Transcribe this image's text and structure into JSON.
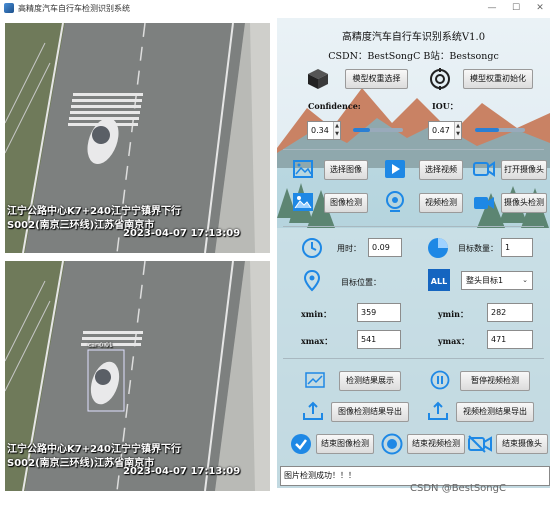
{
  "window": {
    "title": "高精度汽车自行车检测识别系统",
    "controls": [
      "—",
      "☐",
      "✕"
    ]
  },
  "top_image": {
    "overlay_line1": "江宁公路中心K7+240江宁宁镇界下行",
    "overlay_line2": "S002(南京三环线)江苏省南京市",
    "timestamp": "2023-04-07 17:13:09"
  },
  "bottom_image": {
    "overlay_line1": "江宁公路中心K7+240江宁宁镇界下行",
    "overlay_line2": "S002(南京三环线)江苏省南京市",
    "timestamp": "2023-04-07 17:13:09",
    "detection_label": "car 0.91"
  },
  "header": {
    "system_title": "高精度汽车自行车识别系统V1.0",
    "csdn_line": "CSDN：BestSongC   B站：Bestsongc"
  },
  "model": {
    "select_label": "模型权重选择",
    "init_label": "模型权重初始化"
  },
  "params": {
    "confidence_label": "Confidence:",
    "confidence_value": "0.34",
    "confidence_fraction": 0.34,
    "iou_label": "IOU：",
    "iou_value": "0.47",
    "iou_fraction": 0.47
  },
  "actions": {
    "select_image": "选择图像",
    "select_video": "选择视频",
    "open_camera": "打开摄像头",
    "image_detect": "图像检测",
    "video_detect": "视频检测",
    "camera_detect": "摄像头检测"
  },
  "results": {
    "time_label": "用时：",
    "time_value": "0.09",
    "count_label": "目标数量：",
    "count_value": "1",
    "position_label": "目标位置：",
    "target_select": "整头目标1",
    "xmin_label": "xmin：",
    "xmin_value": "359",
    "ymin_label": "ymin：",
    "ymin_value": "282",
    "xmax_label": "xmax：",
    "xmax_value": "541",
    "ymax_label": "ymax：",
    "ymax_value": "471"
  },
  "controls": {
    "show_results": "检测结果展示",
    "pause_video": "暂停视频检测",
    "export_image": "图像检测结果导出",
    "export_video": "视频检测结果导出",
    "end_image": "结束图像检测",
    "end_video": "结束视频检测",
    "end_camera": "结束摄像头"
  },
  "status": {
    "message": "图片检测成功！！！"
  },
  "watermark": "CSDN @BestSongC",
  "colors": {
    "accent": "#2a7fd4",
    "icon_blue": "#1e88e5",
    "detection_box": "#e0e0ff"
  }
}
